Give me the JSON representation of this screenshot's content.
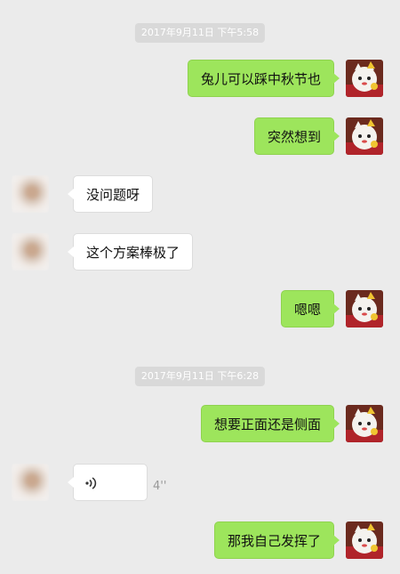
{
  "colors": {
    "background": "#ebebeb",
    "self_bubble": "#9de55c",
    "other_bubble": "#ffffff",
    "timestamp_bg": "#d9d9d9"
  },
  "timestamps": [
    "2017年9月11日 下午5:58",
    "2017年9月11日 下午6:28"
  ],
  "messages": [
    {
      "sender": "self",
      "text": "兔儿可以踩中秋节也"
    },
    {
      "sender": "self",
      "text": "突然想到"
    },
    {
      "sender": "other",
      "text": "没问题呀"
    },
    {
      "sender": "other",
      "text": "这个方案棒极了"
    },
    {
      "sender": "self",
      "text": "嗯嗯"
    },
    {
      "sender": "self",
      "text": "想要正面还是侧面"
    },
    {
      "sender": "other",
      "type": "voice",
      "duration": "4''"
    },
    {
      "sender": "self",
      "text": "那我自己发挥了"
    }
  ],
  "icons": {
    "self_avatar": "lucky-cat-avatar-icon",
    "other_avatar": "blurred-person-avatar-icon",
    "voice": "voice-wave-icon"
  }
}
